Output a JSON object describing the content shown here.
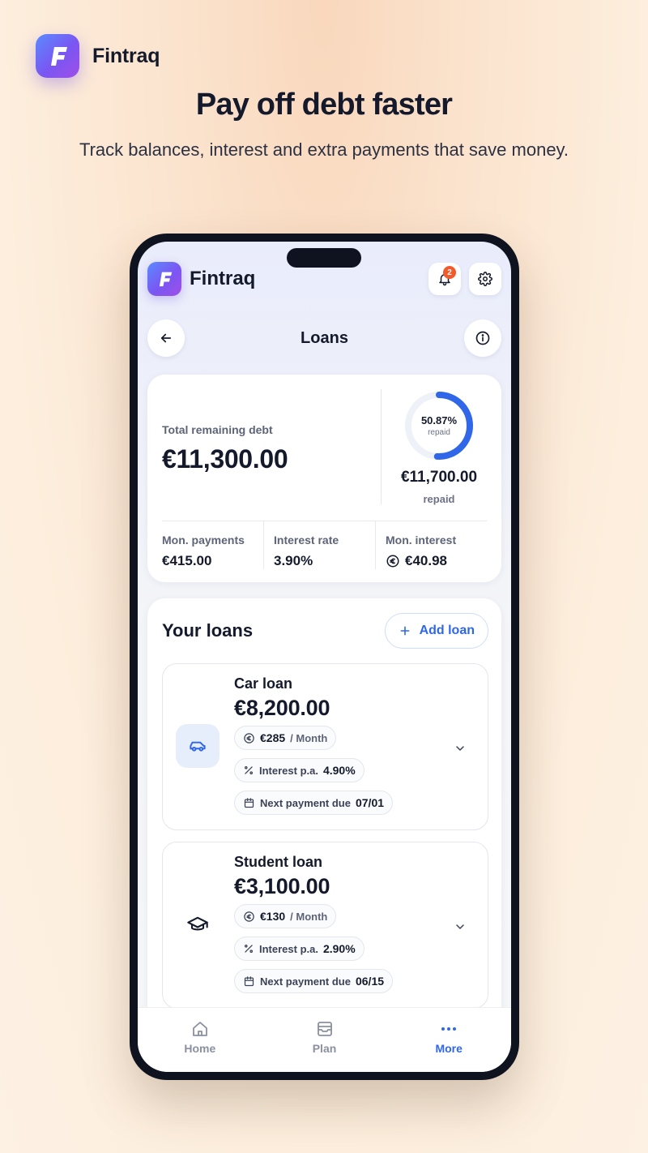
{
  "brand": {
    "name": "Fintraq",
    "logo_letter": "F"
  },
  "hero": {
    "title": "Pay off debt faster",
    "subtitle": "Track balances, interest and extra payments that save money."
  },
  "app": {
    "name": "Fintraq",
    "notifications_count": "2",
    "page_title": "Loans"
  },
  "summary": {
    "total_label": "Total remaining debt",
    "total_value": "€11,300.00",
    "progress": 0.5087,
    "progress_text": "50.87%",
    "progress_sub": "repaid",
    "repaid_amount": "€11,700.00",
    "repaid_label": "repaid",
    "stats": [
      {
        "label": "Mon. payments",
        "value": "€415.00"
      },
      {
        "label": "Interest rate",
        "value": "3.90%"
      },
      {
        "label": "Mon. interest",
        "value": "€40.98"
      }
    ]
  },
  "loans": {
    "title": "Your loans",
    "add_label": "Add loan",
    "items": [
      {
        "name": "Car loan",
        "amount": "€8,200.00",
        "monthly": "€285",
        "monthly_unit": "/ Month",
        "interest_label": "Interest p.a.",
        "interest": "4.90%",
        "due_label": "Next payment due",
        "due": "07/01",
        "icon": "car-icon"
      },
      {
        "name": "Student loan",
        "amount": "€3,100.00",
        "monthly": "€130",
        "monthly_unit": "/ Month",
        "interest_label": "Interest p.a.",
        "interest": "2.90%",
        "due_label": "Next payment due",
        "due": "06/15",
        "icon": "graduation-cap-icon"
      }
    ]
  },
  "tabs": [
    {
      "label": "Home",
      "active": false
    },
    {
      "label": "Plan",
      "active": false
    },
    {
      "label": "More",
      "active": true
    }
  ],
  "colors": {
    "accent": "#2f67e8",
    "badge": "#f15a2b",
    "text": "#141a2b"
  }
}
